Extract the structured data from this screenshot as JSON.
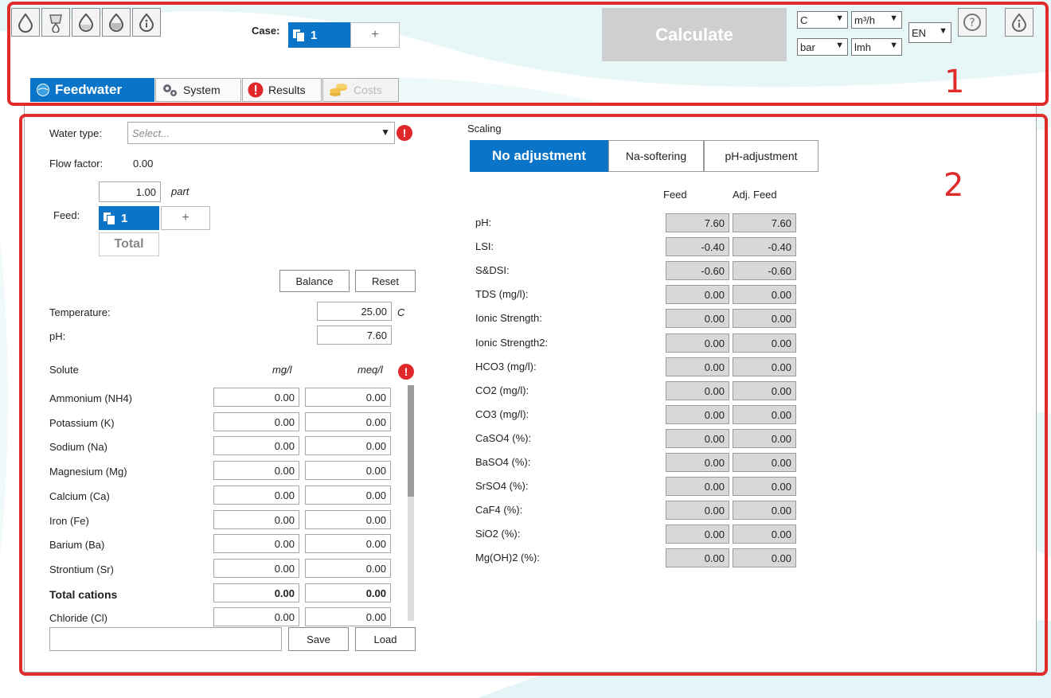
{
  "toolbar": {
    "case_label": "Case:",
    "case_value": "1",
    "case_add": "+",
    "calculate": "Calculate",
    "units": {
      "temperature": "C",
      "flow": "m³/h",
      "pressure": "bar",
      "flux": "lmh"
    },
    "language": "EN",
    "icons": [
      "drop-icon",
      "bucket-drop-icon",
      "bucket-icon",
      "bucket-fill-icon",
      "info-icon"
    ]
  },
  "tabs": [
    {
      "label": "Feedwater",
      "icon": "globe-icon",
      "state": "active"
    },
    {
      "label": "System",
      "icon": "gears-icon",
      "state": "normal"
    },
    {
      "label": "Results",
      "icon": "warning-icon",
      "state": "normal"
    },
    {
      "label": "Costs",
      "icon": "coins-icon",
      "state": "disabled"
    }
  ],
  "annotations": {
    "n1": "1",
    "n2": "2"
  },
  "feedwater": {
    "water_type_label": "Water type:",
    "water_type_placeholder": "Select...",
    "flow_factor_label": "Flow factor:",
    "flow_factor_value": "0.00",
    "part_value": "1.00",
    "part_label": "part",
    "feed_label": "Feed:",
    "feed_value": "1",
    "feed_add": "+",
    "total_label": "Total",
    "balance": "Balance",
    "reset": "Reset",
    "temperature_label": "Temperature:",
    "temperature_value": "25.00",
    "temperature_unit": "C",
    "ph_label": "pH:",
    "ph_value": "7.60",
    "solute_header": "Solute",
    "mgl_header": "mg/l",
    "meql_header": "meq/l",
    "solutes": [
      {
        "name": "Ammonium (NH4)",
        "mgl": "0.00",
        "meql": "0.00"
      },
      {
        "name": "Potassium (K)",
        "mgl": "0.00",
        "meql": "0.00"
      },
      {
        "name": "Sodium (Na)",
        "mgl": "0.00",
        "meql": "0.00"
      },
      {
        "name": "Magnesium (Mg)",
        "mgl": "0.00",
        "meql": "0.00"
      },
      {
        "name": "Calcium (Ca)",
        "mgl": "0.00",
        "meql": "0.00"
      },
      {
        "name": "Iron (Fe)",
        "mgl": "0.00",
        "meql": "0.00"
      },
      {
        "name": "Barium (Ba)",
        "mgl": "0.00",
        "meql": "0.00"
      },
      {
        "name": "Strontium (Sr)",
        "mgl": "0.00",
        "meql": "0.00"
      },
      {
        "name": "Total cations",
        "mgl": "0.00",
        "meql": "0.00"
      },
      {
        "name": "Chloride (Cl)",
        "mgl": "0.00",
        "meql": "0.00"
      }
    ],
    "save": "Save",
    "load": "Load"
  },
  "scaling": {
    "title": "Scaling",
    "modes": [
      "No adjustment",
      "Na-softering",
      "pH-adjustment"
    ],
    "active_mode": "No adjustment",
    "col_feed": "Feed",
    "col_adj_feed": "Adj. Feed",
    "rows": [
      {
        "label": "pH:",
        "feed": "7.60",
        "adj": "7.60"
      },
      {
        "label": "LSI:",
        "feed": "-0.40",
        "adj": "-0.40"
      },
      {
        "label": "S&DSI:",
        "feed": "-0.60",
        "adj": "-0.60"
      },
      {
        "label": "TDS (mg/l):",
        "feed": "0.00",
        "adj": "0.00"
      },
      {
        "label": "Ionic Strength:",
        "feed": "0.00",
        "adj": "0.00"
      },
      {
        "label": "Ionic Strength2:",
        "feed": "0.00",
        "adj": "0.00"
      },
      {
        "label": "HCO3 (mg/l):",
        "feed": "0.00",
        "adj": "0.00"
      },
      {
        "label": "CO2 (mg/l):",
        "feed": "0.00",
        "adj": "0.00"
      },
      {
        "label": "CO3 (mg/l):",
        "feed": "0.00",
        "adj": "0.00"
      },
      {
        "label": "CaSO4 (%):",
        "feed": "0.00",
        "adj": "0.00"
      },
      {
        "label": "BaSO4 (%):",
        "feed": "0.00",
        "adj": "0.00"
      },
      {
        "label": "SrSO4 (%):",
        "feed": "0.00",
        "adj": "0.00"
      },
      {
        "label": "CaF4 (%):",
        "feed": "0.00",
        "adj": "0.00"
      },
      {
        "label": "SiO2 (%):",
        "feed": "0.00",
        "adj": "0.00"
      },
      {
        "label": "Mg(OH)2 (%):",
        "feed": "0.00",
        "adj": "0.00"
      }
    ]
  },
  "colors": {
    "accent": "#0a74c9",
    "annotation": "#e02b2b",
    "warning": "#e0282a",
    "disabled": "#cfcfcf"
  }
}
